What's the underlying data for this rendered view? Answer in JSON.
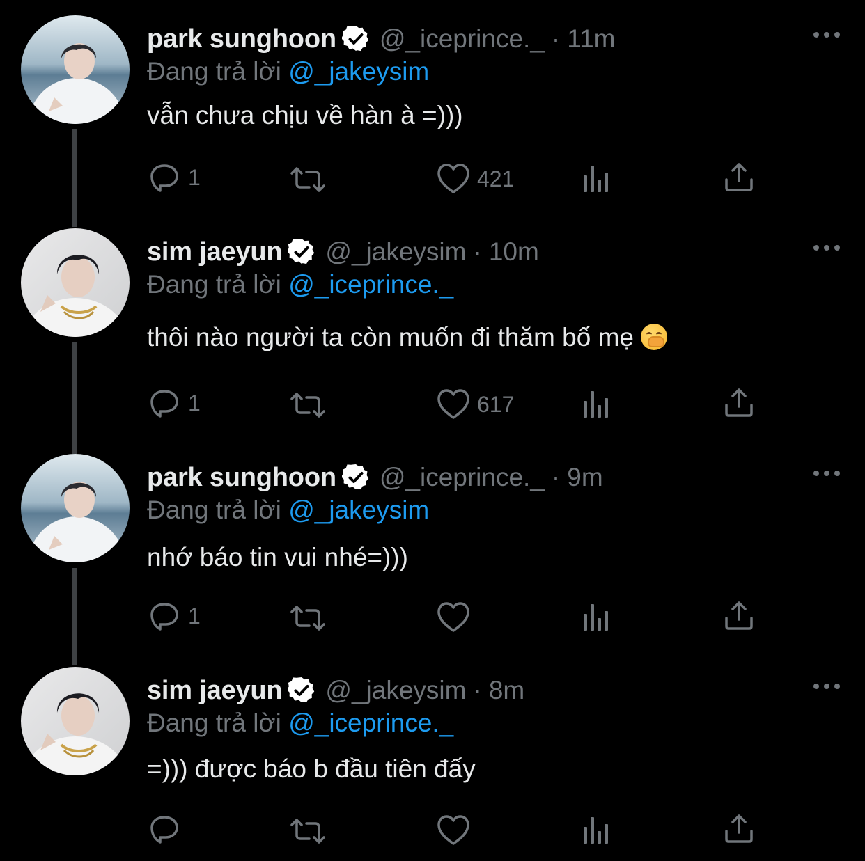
{
  "colors": {
    "background": "#000000",
    "secondary": "#71767b",
    "link": "#1d9bf0",
    "text": "#e7e9ea"
  },
  "tweets": [
    {
      "name": "park sunghoon",
      "handle": "@_iceprince._",
      "separator": "·",
      "time": "11m",
      "reply_prefix": "Đang trả lời",
      "reply_mention": "@_jakeysim",
      "text": "vẫn chưa chịu về hàn à =)))",
      "replies": "1",
      "retweets": "",
      "likes": "421",
      "avatar": "sunghoon-avatar"
    },
    {
      "name": "sim jaeyun",
      "handle": "@_jakeysim",
      "separator": "·",
      "time": "10m",
      "reply_prefix": "Đang trả lời",
      "reply_mention": "@_iceprince._",
      "text": "thôi nào người ta còn muốn đi thăm bố mẹ",
      "emoji": "face-with-hand-over-mouth",
      "replies": "1",
      "retweets": "",
      "likes": "617",
      "avatar": "jaeyun-avatar"
    },
    {
      "name": "park sunghoon",
      "handle": "@_iceprince._",
      "separator": "·",
      "time": "9m",
      "reply_prefix": "Đang trả lời",
      "reply_mention": "@_jakeysim",
      "text": "nhớ báo tin vui nhé=)))",
      "replies": "1",
      "retweets": "",
      "likes": "",
      "avatar": "sunghoon-avatar"
    },
    {
      "name": "sim jaeyun",
      "handle": "@_jakeysim",
      "separator": "·",
      "time": "8m",
      "reply_prefix": "Đang trả lời",
      "reply_mention": "@_iceprince._",
      "text": "=))) được báo b đầu tiên đấy",
      "replies": "",
      "retweets": "",
      "likes": "",
      "avatar": "jaeyun-avatar"
    }
  ]
}
